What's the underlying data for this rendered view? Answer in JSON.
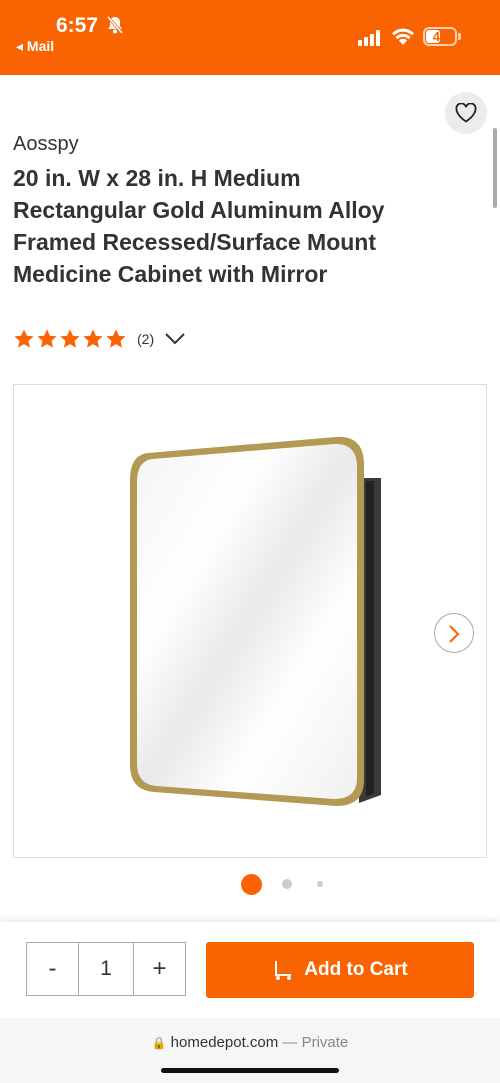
{
  "status": {
    "time": "6:57",
    "back_app": "◂ Mail",
    "battery": "45"
  },
  "product": {
    "brand": "Aosspy",
    "title": "20 in. W x 28 in. H Medium Rectangular Gold Aluminum Alloy Framed Recessed/Surface Mount Medicine Cabinet with Mirror",
    "rating_stars": 5,
    "review_count": "(2)"
  },
  "gallery": {
    "current_index": 1,
    "total": 3
  },
  "purchase": {
    "minus": "-",
    "quantity": "1",
    "plus": "+",
    "add_to_cart": "Add to Cart"
  },
  "browser": {
    "domain": "homedepot.com",
    "mode": "— Private"
  },
  "colors": {
    "accent": "#f96302",
    "frame": "#b29a55"
  }
}
